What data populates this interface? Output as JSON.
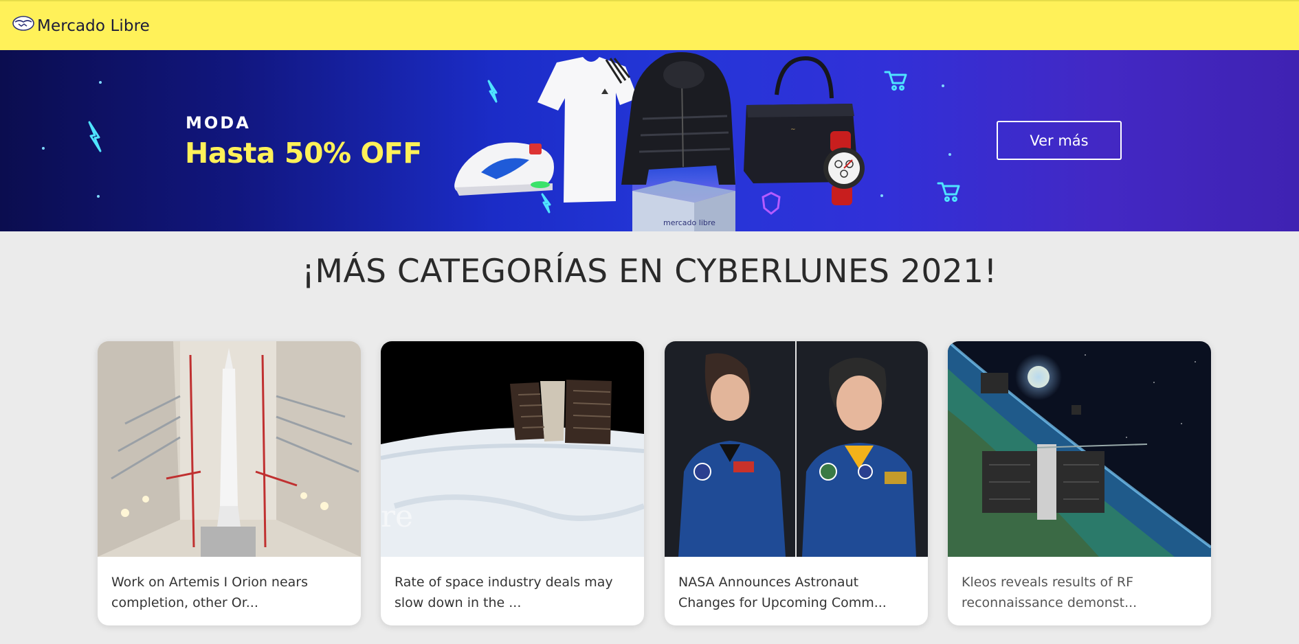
{
  "header": {
    "brand": "Mercado Libre",
    "logo_icon": "mercado-libre-handshake-icon",
    "background": "#fff159"
  },
  "banner": {
    "kicker": "MODA",
    "headline": "Hasta 50% OFF",
    "cta_label": "Ver más",
    "headline_color": "#fff159",
    "box_text": "mercado libre",
    "products": [
      "sneaker",
      "white-tshirt",
      "black-puffer-jacket",
      "black-tote-bag",
      "red-watch"
    ],
    "decorations": [
      "lightning-icon",
      "shopping-cart-icon",
      "shield-icon"
    ]
  },
  "section": {
    "title": "¡MÁS CATEGORÍAS EN CYBERLUNES 2021!"
  },
  "cards": [
    {
      "text": "Work on Artemis I Orion nears completion, other Or...",
      "image": "rocket-in-assembly-hangar"
    },
    {
      "text": "Rate of space industry deals may slow down in the ...",
      "image": "satellite-over-earth",
      "image_watermark": "re"
    },
    {
      "text": "NASA Announces Astronaut Changes for Upcoming Comm...",
      "image": "two-astronaut-portraits"
    },
    {
      "text": "Kleos reveals results of RF reconnaissance demonst...",
      "image": "satellites-orbiting-earth"
    }
  ]
}
